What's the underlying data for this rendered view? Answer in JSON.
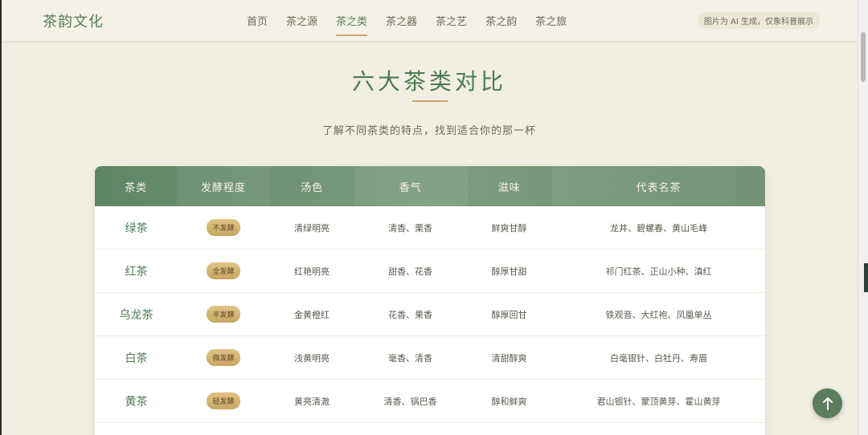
{
  "header": {
    "logo": "茶韵文化",
    "nav": [
      {
        "label": "首页",
        "active": false
      },
      {
        "label": "茶之源",
        "active": false
      },
      {
        "label": "茶之类",
        "active": true
      },
      {
        "label": "茶之器",
        "active": false
      },
      {
        "label": "茶之艺",
        "active": false
      },
      {
        "label": "茶之韵",
        "active": false
      },
      {
        "label": "茶之旅",
        "active": false
      }
    ],
    "ai_notice": "图片为 AI 生成，仅象科普展示"
  },
  "main": {
    "title": "六大茶类对比",
    "subtitle": "了解不同茶类的特点，找到适合你的那一杯"
  },
  "table": {
    "headers": [
      "茶类",
      "发酵程度",
      "汤色",
      "香气",
      "滋味",
      "代表名茶"
    ],
    "rows": [
      {
        "name": "绿茶",
        "fermentation": "不发酵",
        "color": "清绿明亮",
        "aroma": "清香、栗香",
        "taste": "鲜爽甘醇",
        "famous": "龙井、碧螺春、黄山毛峰"
      },
      {
        "name": "红茶",
        "fermentation": "全发酵",
        "color": "红艳明亮",
        "aroma": "甜香、花香",
        "taste": "醇厚甘甜",
        "famous": "祁门红茶、正山小种、滇红"
      },
      {
        "name": "乌龙茶",
        "fermentation": "半发酵",
        "color": "金黄橙红",
        "aroma": "花香、果香",
        "taste": "醇厚回甘",
        "famous": "铁观音、大红袍、凤凰单丛"
      },
      {
        "name": "白茶",
        "fermentation": "微发酵",
        "color": "浅黄明亮",
        "aroma": "毫香、清香",
        "taste": "清甜醇爽",
        "famous": "白毫银针、白牡丹、寿眉"
      },
      {
        "name": "黄茶",
        "fermentation": "轻发酵",
        "color": "黄亮清澈",
        "aroma": "清香、锅巴香",
        "taste": "醇和鲜爽",
        "famous": "君山银针、蒙顶黄芽、霍山黄芽"
      }
    ]
  },
  "colors": {
    "accent_green": "#5b7d5c",
    "accent_gold": "#c9a96b",
    "background": "#f1eee4"
  },
  "icons": {
    "back_to_top": "arrow-up-icon"
  }
}
